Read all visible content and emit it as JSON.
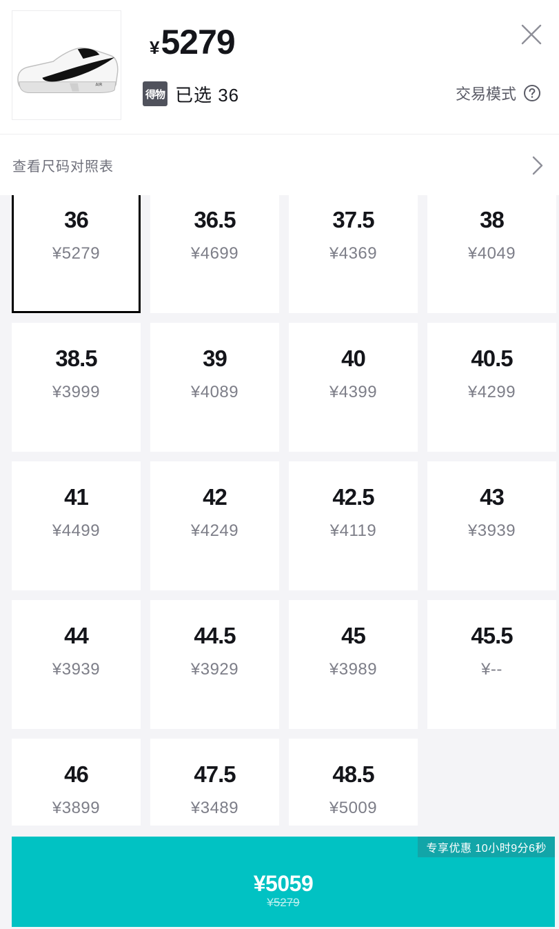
{
  "header": {
    "price_symbol": "¥",
    "price": "5279",
    "brand_badge": "得物",
    "selected_text": "已选 36",
    "trade_mode_label": "交易模式",
    "product_image": "white-sneaker-black-swoosh"
  },
  "size_chart": {
    "label": "查看尺码对照表"
  },
  "sizes": [
    {
      "size": "36",
      "price": "¥5279",
      "selected": true
    },
    {
      "size": "36.5",
      "price": "¥4699"
    },
    {
      "size": "37.5",
      "price": "¥4369"
    },
    {
      "size": "38",
      "price": "¥4049"
    },
    {
      "size": "38.5",
      "price": "¥3999"
    },
    {
      "size": "39",
      "price": "¥4089"
    },
    {
      "size": "40",
      "price": "¥4399"
    },
    {
      "size": "40.5",
      "price": "¥4299"
    },
    {
      "size": "41",
      "price": "¥4499"
    },
    {
      "size": "42",
      "price": "¥4249"
    },
    {
      "size": "42.5",
      "price": "¥4119"
    },
    {
      "size": "43",
      "price": "¥3939"
    },
    {
      "size": "44",
      "price": "¥3939"
    },
    {
      "size": "44.5",
      "price": "¥3929"
    },
    {
      "size": "45",
      "price": "¥3989"
    },
    {
      "size": "45.5",
      "price": "¥--"
    },
    {
      "size": "46",
      "price": "¥3899"
    },
    {
      "size": "47.5",
      "price": "¥3489"
    },
    {
      "size": "48.5",
      "price": "¥5009"
    }
  ],
  "buy": {
    "promo": "专享优惠 10小时9分6秒",
    "price": "¥5059",
    "original_price": "¥5279"
  },
  "colors": {
    "accent": "#01c2c3",
    "promo_bg": "#12a5a8",
    "badge_bg": "#50525c",
    "selected_border": "#000000"
  },
  "icons": {
    "close": "close-icon",
    "help": "help-circle-icon",
    "chevron": "chevron-right-icon"
  }
}
